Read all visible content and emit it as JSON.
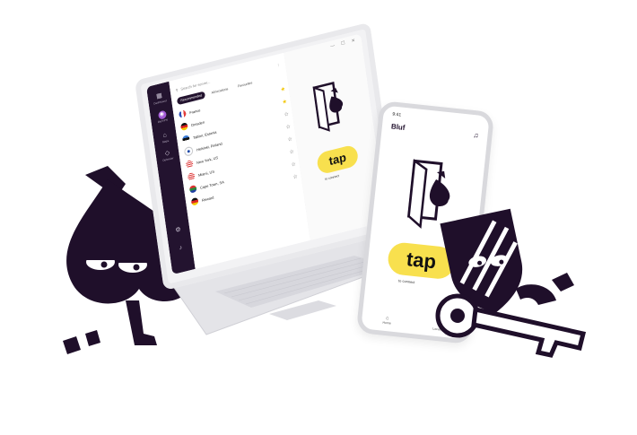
{
  "desktop_app": {
    "window_controls": "— ☐ ✕",
    "sidebar": {
      "items": [
        {
          "icon": "grid-icon",
          "label": "Dashboard"
        },
        {
          "icon": "brand-icon",
          "label": "BlufVPN"
        },
        {
          "icon": "map-icon",
          "label": "Maps"
        },
        {
          "icon": "shield-icon",
          "label": "Defender"
        },
        {
          "icon": "settings-icon",
          "label": ""
        },
        {
          "icon": "bell-icon",
          "label": ""
        }
      ]
    },
    "search": {
      "placeholder": "Search for server..."
    },
    "tabs": [
      "Recommended",
      "All locations",
      "Favourites"
    ],
    "locations": [
      {
        "name": "France",
        "flag": "fr",
        "favourite": false
      },
      {
        "name": "Dresden",
        "flag": "de",
        "favourite": true
      },
      {
        "name": "Tallinn, Estonia",
        "flag": "ee",
        "favourite": false
      },
      {
        "name": "Helsinki, Finland",
        "flag": "fi",
        "favourite": false
      },
      {
        "name": "New York, US",
        "flag": "us",
        "favourite": false
      },
      {
        "name": "Miami, US",
        "flag": "us",
        "favourite": false
      },
      {
        "name": "Cape Town, SA",
        "flag": "za",
        "favourite": false
      },
      {
        "name": "Reward",
        "flag": "de",
        "favourite": false
      }
    ],
    "connect": {
      "button": "tap",
      "subtitle": "to connect"
    }
  },
  "phone_app": {
    "time": "9:41",
    "brand": "Bluf",
    "connect": {
      "button": "tap",
      "subtitle": "to connect"
    },
    "nav": [
      {
        "icon": "home-icon",
        "label": "Home"
      },
      {
        "icon": "location-pin-icon",
        "label": "Locations"
      }
    ]
  },
  "colors": {
    "brand_dark": "#23132f",
    "accent_yellow": "#f8e04e",
    "accent_purple": "#a35ad6"
  }
}
